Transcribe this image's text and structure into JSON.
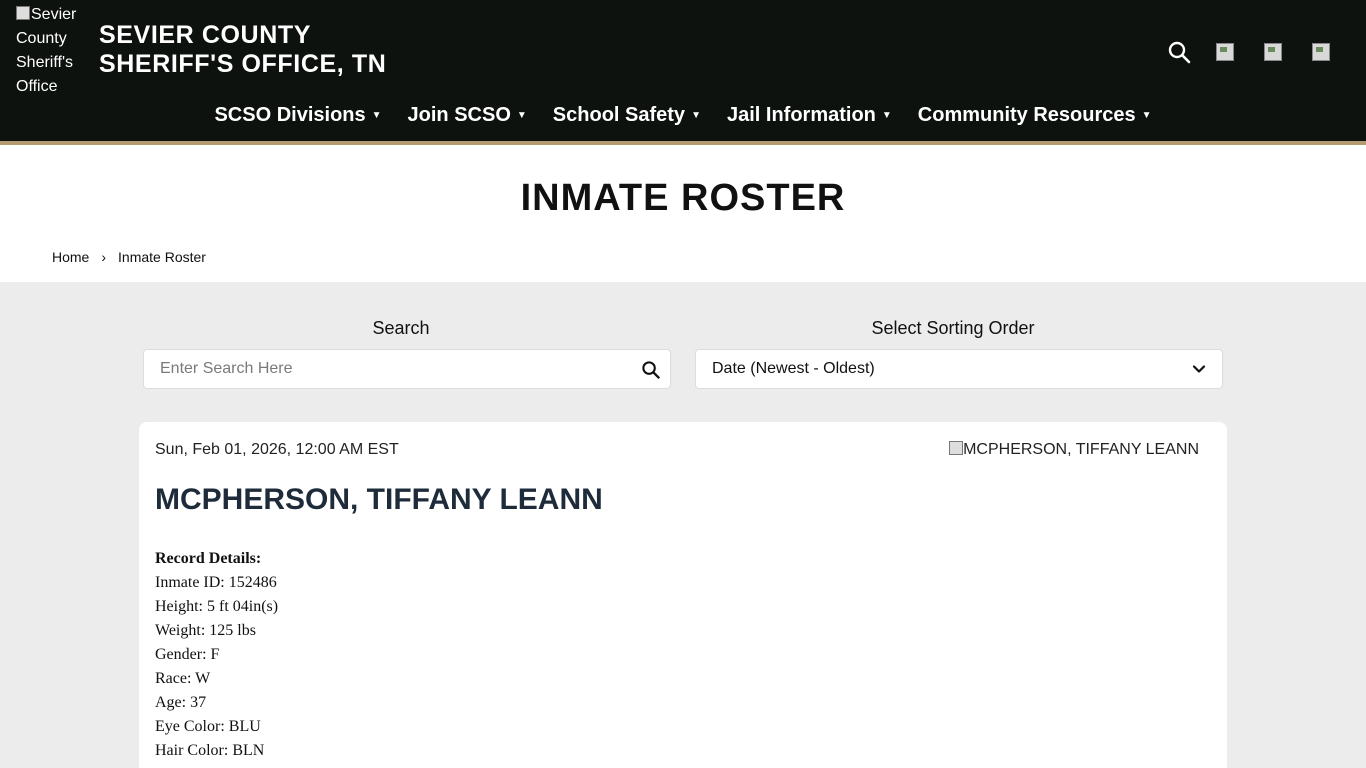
{
  "header": {
    "logo_alt": "Sevier County Sheriff's Office",
    "title_line1": "SEVIER COUNTY",
    "title_line2": "SHERIFF'S OFFICE, TN",
    "icons": [
      "search-icon",
      "facebook-icon",
      "twitter-icon",
      "instagram-icon"
    ]
  },
  "nav": {
    "items": [
      {
        "label": "SCSO Divisions"
      },
      {
        "label": "Join SCSO"
      },
      {
        "label": "School Safety"
      },
      {
        "label": "Jail Information"
      },
      {
        "label": "Community Resources"
      }
    ]
  },
  "page": {
    "title": "INMATE ROSTER",
    "breadcrumb": {
      "home": "Home",
      "current": "Inmate Roster"
    }
  },
  "search": {
    "label": "Search",
    "placeholder": "Enter Search Here",
    "value": ""
  },
  "sort": {
    "label": "Select Sorting Order",
    "selected": "Date (Newest - Oldest)"
  },
  "records": [
    {
      "date": "Sun, Feb 01, 2026, 12:00 AM EST",
      "photo_alt": "MCPHERSON, TIFFANY LEANN",
      "name": "MCPHERSON, TIFFANY LEANN",
      "details_heading": "Record Details:",
      "inmate_id": "Inmate ID: 152486",
      "height": "Height: 5 ft 04in(s)",
      "weight": "Weight: 125 lbs",
      "gender": "Gender: F",
      "race": "Race: W",
      "age": "Age: 37",
      "eye_color": "Eye Color: BLU",
      "hair_color": "Hair Color: BLN"
    }
  ],
  "colors": {
    "header_bg": "#0e120f",
    "header_accent": "#b49a72",
    "page_bg": "#ececec",
    "name_color": "#1e2b3a"
  }
}
